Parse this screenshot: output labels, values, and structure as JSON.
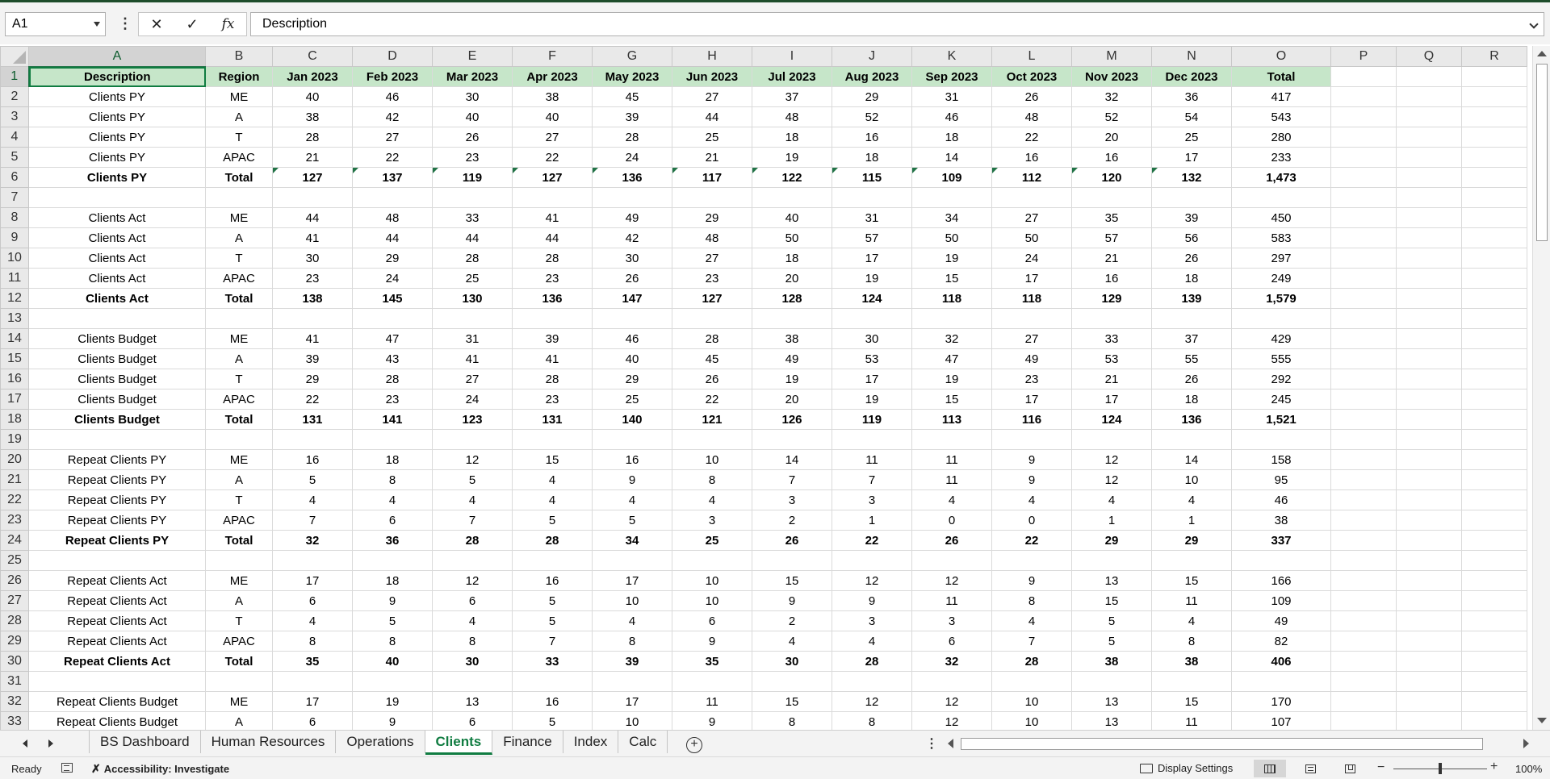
{
  "namebox": "A1",
  "formula_bar": {
    "cancel_icon": "✕",
    "enter_icon": "✓",
    "fx_label": "fx",
    "content": "Description"
  },
  "columns": [
    {
      "letter": "A",
      "width": 219
    },
    {
      "letter": "B",
      "width": 83
    },
    {
      "letter": "C",
      "width": 99
    },
    {
      "letter": "D",
      "width": 99
    },
    {
      "letter": "E",
      "width": 99
    },
    {
      "letter": "F",
      "width": 99
    },
    {
      "letter": "G",
      "width": 99
    },
    {
      "letter": "H",
      "width": 99
    },
    {
      "letter": "I",
      "width": 99
    },
    {
      "letter": "J",
      "width": 99
    },
    {
      "letter": "K",
      "width": 99
    },
    {
      "letter": "L",
      "width": 99
    },
    {
      "letter": "M",
      "width": 99
    },
    {
      "letter": "N",
      "width": 99
    },
    {
      "letter": "O",
      "width": 123
    },
    {
      "letter": "P",
      "width": 81
    },
    {
      "letter": "Q",
      "width": 81
    },
    {
      "letter": "R",
      "width": 81
    }
  ],
  "rows": [
    {
      "n": 1,
      "style": "hdr",
      "cells": [
        "Description",
        "Region",
        "Jan 2023",
        "Feb 2023",
        "Mar 2023",
        "Apr 2023",
        "May 2023",
        "Jun 2023",
        "Jul 2023",
        "Aug 2023",
        "Sep 2023",
        "Oct 2023",
        "Nov 2023",
        "Dec 2023",
        "Total"
      ]
    },
    {
      "n": 2,
      "style": "data",
      "cells": [
        "Clients PY",
        "ME",
        "40",
        "46",
        "30",
        "38",
        "45",
        "27",
        "37",
        "29",
        "31",
        "26",
        "32",
        "36",
        "417"
      ]
    },
    {
      "n": 3,
      "style": "data",
      "cells": [
        "Clients PY",
        "A",
        "38",
        "42",
        "40",
        "40",
        "39",
        "44",
        "48",
        "52",
        "46",
        "48",
        "52",
        "54",
        "543"
      ]
    },
    {
      "n": 4,
      "style": "data",
      "cells": [
        "Clients PY",
        "T",
        "28",
        "27",
        "26",
        "27",
        "28",
        "25",
        "18",
        "16",
        "18",
        "22",
        "20",
        "25",
        "280"
      ]
    },
    {
      "n": 5,
      "style": "data",
      "cells": [
        "Clients PY",
        "APAC",
        "21",
        "22",
        "23",
        "22",
        "24",
        "21",
        "19",
        "18",
        "14",
        "16",
        "16",
        "17",
        "233"
      ]
    },
    {
      "n": 6,
      "style": "bold",
      "flags": true,
      "cells": [
        "Clients PY",
        "Total",
        "127",
        "137",
        "119",
        "127",
        "136",
        "117",
        "122",
        "115",
        "109",
        "112",
        "120",
        "132",
        "1,473"
      ]
    },
    {
      "n": 7,
      "style": "empty",
      "cells": []
    },
    {
      "n": 8,
      "style": "data",
      "cells": [
        "Clients Act",
        "ME",
        "44",
        "48",
        "33",
        "41",
        "49",
        "29",
        "40",
        "31",
        "34",
        "27",
        "35",
        "39",
        "450"
      ]
    },
    {
      "n": 9,
      "style": "data",
      "cells": [
        "Clients Act",
        "A",
        "41",
        "44",
        "44",
        "44",
        "42",
        "48",
        "50",
        "57",
        "50",
        "50",
        "57",
        "56",
        "583"
      ]
    },
    {
      "n": 10,
      "style": "data",
      "cells": [
        "Clients Act",
        "T",
        "30",
        "29",
        "28",
        "28",
        "30",
        "27",
        "18",
        "17",
        "19",
        "24",
        "21",
        "26",
        "297"
      ]
    },
    {
      "n": 11,
      "style": "data",
      "cells": [
        "Clients Act",
        "APAC",
        "23",
        "24",
        "25",
        "23",
        "26",
        "23",
        "20",
        "19",
        "15",
        "17",
        "16",
        "18",
        "249"
      ]
    },
    {
      "n": 12,
      "style": "bold",
      "cells": [
        "Clients Act",
        "Total",
        "138",
        "145",
        "130",
        "136",
        "147",
        "127",
        "128",
        "124",
        "118",
        "118",
        "129",
        "139",
        "1,579"
      ]
    },
    {
      "n": 13,
      "style": "empty",
      "cells": []
    },
    {
      "n": 14,
      "style": "data",
      "cells": [
        "Clients Budget",
        "ME",
        "41",
        "47",
        "31",
        "39",
        "46",
        "28",
        "38",
        "30",
        "32",
        "27",
        "33",
        "37",
        "429"
      ]
    },
    {
      "n": 15,
      "style": "data",
      "cells": [
        "Clients Budget",
        "A",
        "39",
        "43",
        "41",
        "41",
        "40",
        "45",
        "49",
        "53",
        "47",
        "49",
        "53",
        "55",
        "555"
      ]
    },
    {
      "n": 16,
      "style": "data",
      "cells": [
        "Clients Budget",
        "T",
        "29",
        "28",
        "27",
        "28",
        "29",
        "26",
        "19",
        "17",
        "19",
        "23",
        "21",
        "26",
        "292"
      ]
    },
    {
      "n": 17,
      "style": "data",
      "cells": [
        "Clients Budget",
        "APAC",
        "22",
        "23",
        "24",
        "23",
        "25",
        "22",
        "20",
        "19",
        "15",
        "17",
        "17",
        "18",
        "245"
      ]
    },
    {
      "n": 18,
      "style": "bold",
      "cells": [
        "Clients Budget",
        "Total",
        "131",
        "141",
        "123",
        "131",
        "140",
        "121",
        "126",
        "119",
        "113",
        "116",
        "124",
        "136",
        "1,521"
      ]
    },
    {
      "n": 19,
      "style": "empty",
      "cells": []
    },
    {
      "n": 20,
      "style": "data",
      "cells": [
        "Repeat Clients PY",
        "ME",
        "16",
        "18",
        "12",
        "15",
        "16",
        "10",
        "14",
        "11",
        "11",
        "9",
        "12",
        "14",
        "158"
      ]
    },
    {
      "n": 21,
      "style": "data",
      "cells": [
        "Repeat Clients PY",
        "A",
        "5",
        "8",
        "5",
        "4",
        "9",
        "8",
        "7",
        "7",
        "11",
        "9",
        "12",
        "10",
        "95"
      ]
    },
    {
      "n": 22,
      "style": "data",
      "cells": [
        "Repeat Clients PY",
        "T",
        "4",
        "4",
        "4",
        "4",
        "4",
        "4",
        "3",
        "3",
        "4",
        "4",
        "4",
        "4",
        "46"
      ]
    },
    {
      "n": 23,
      "style": "data",
      "cells": [
        "Repeat Clients PY",
        "APAC",
        "7",
        "6",
        "7",
        "5",
        "5",
        "3",
        "2",
        "1",
        "0",
        "0",
        "1",
        "1",
        "38"
      ]
    },
    {
      "n": 24,
      "style": "bold",
      "cells": [
        "Repeat Clients PY",
        "Total",
        "32",
        "36",
        "28",
        "28",
        "34",
        "25",
        "26",
        "22",
        "26",
        "22",
        "29",
        "29",
        "337"
      ]
    },
    {
      "n": 25,
      "style": "empty",
      "cells": []
    },
    {
      "n": 26,
      "style": "data",
      "cells": [
        "Repeat Clients Act",
        "ME",
        "17",
        "18",
        "12",
        "16",
        "17",
        "10",
        "15",
        "12",
        "12",
        "9",
        "13",
        "15",
        "166"
      ]
    },
    {
      "n": 27,
      "style": "data",
      "cells": [
        "Repeat Clients Act",
        "A",
        "6",
        "9",
        "6",
        "5",
        "10",
        "10",
        "9",
        "9",
        "11",
        "8",
        "15",
        "11",
        "109"
      ]
    },
    {
      "n": 28,
      "style": "data",
      "cells": [
        "Repeat Clients Act",
        "T",
        "4",
        "5",
        "4",
        "5",
        "4",
        "6",
        "2",
        "3",
        "3",
        "4",
        "5",
        "4",
        "49"
      ]
    },
    {
      "n": 29,
      "style": "data",
      "cells": [
        "Repeat Clients Act",
        "APAC",
        "8",
        "8",
        "8",
        "7",
        "8",
        "9",
        "4",
        "4",
        "6",
        "7",
        "5",
        "8",
        "82"
      ]
    },
    {
      "n": 30,
      "style": "bold",
      "cells": [
        "Repeat Clients Act",
        "Total",
        "35",
        "40",
        "30",
        "33",
        "39",
        "35",
        "30",
        "28",
        "32",
        "28",
        "38",
        "38",
        "406"
      ]
    },
    {
      "n": 31,
      "style": "empty",
      "cells": []
    },
    {
      "n": 32,
      "style": "data",
      "cells": [
        "Repeat Clients Budget",
        "ME",
        "17",
        "19",
        "13",
        "16",
        "17",
        "11",
        "15",
        "12",
        "12",
        "10",
        "13",
        "15",
        "170"
      ]
    },
    {
      "n": 33,
      "style": "data",
      "cells": [
        "Repeat Clients Budget",
        "A",
        "6",
        "9",
        "6",
        "5",
        "10",
        "9",
        "8",
        "8",
        "12",
        "10",
        "13",
        "11",
        "107"
      ]
    }
  ],
  "sheet_tabs": [
    "BS Dashboard",
    "Human Resources",
    "Operations",
    "Clients",
    "Finance",
    "Index",
    "Calc"
  ],
  "active_tab": "Clients",
  "status": {
    "ready": "Ready",
    "accessibility": "Accessibility: Investigate",
    "display_settings": "Display Settings",
    "zoom": "100%"
  },
  "colors": {
    "header_fill": "#c6e6c9",
    "accent": "#107c41",
    "title_bar": "#1e4d2b"
  },
  "icons": [
    "cancel-icon",
    "enter-icon",
    "fx-icon",
    "macro-icon",
    "accessibility-icon",
    "display-settings-icon",
    "normal-view-icon",
    "page-layout-icon",
    "page-break-icon",
    "add-sheet-icon"
  ]
}
